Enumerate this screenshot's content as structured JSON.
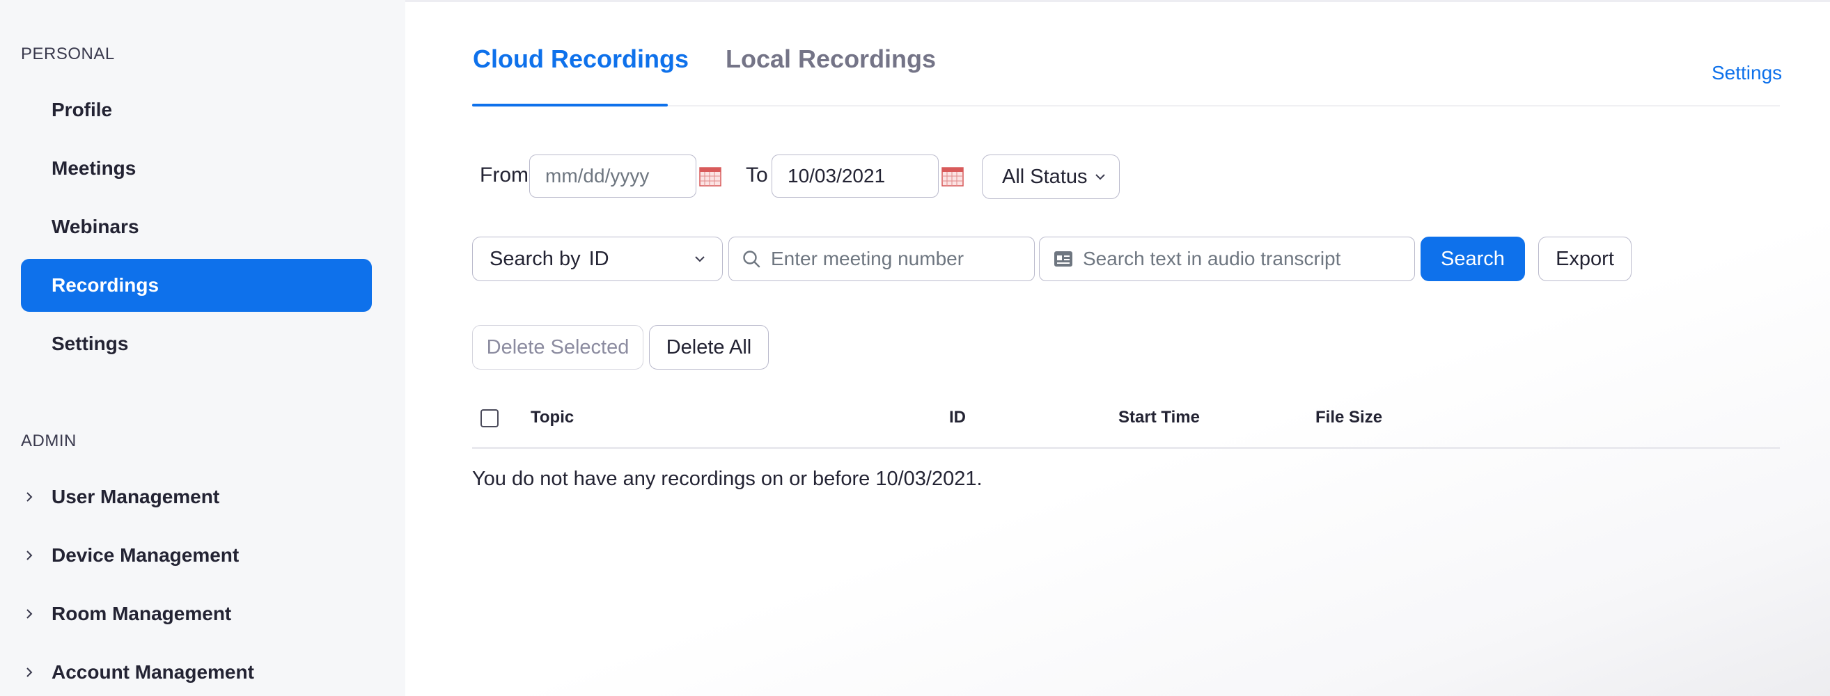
{
  "sidebar": {
    "personal_title": "PERSONAL",
    "personal_items": [
      {
        "label": "Profile"
      },
      {
        "label": "Meetings"
      },
      {
        "label": "Webinars"
      },
      {
        "label": "Recordings",
        "active": true
      },
      {
        "label": "Settings"
      }
    ],
    "admin_title": "ADMIN",
    "admin_items": [
      {
        "label": "User Management"
      },
      {
        "label": "Device Management"
      },
      {
        "label": "Room Management"
      },
      {
        "label": "Account Management"
      }
    ]
  },
  "tabs": [
    {
      "label": "Cloud Recordings",
      "active": true
    },
    {
      "label": "Local Recordings",
      "active": false
    }
  ],
  "settings_link": "Settings",
  "filters": {
    "from_label": "From",
    "from_placeholder": "mm/dd/yyyy",
    "to_label": "To",
    "to_value": "10/03/2021",
    "status_value": "All Status",
    "search_by_label": "Search by",
    "search_by_value": "ID",
    "meeting_placeholder": "Enter meeting number",
    "transcript_placeholder": "Search text in audio transcript",
    "search_button": "Search",
    "export_button": "Export"
  },
  "actions": {
    "delete_selected": "Delete Selected",
    "delete_all": "Delete All"
  },
  "table": {
    "columns": [
      "Topic",
      "ID",
      "Start Time",
      "File Size"
    ],
    "empty_message": "You do not have any recordings on or before 10/03/2021."
  },
  "colors": {
    "accent": "#0e71eb",
    "sidebar_bg": "#f6f7f9"
  }
}
